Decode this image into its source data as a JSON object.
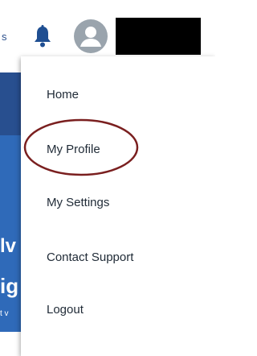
{
  "header": {
    "fragment_text": "s",
    "bell_icon": "bell-icon",
    "avatar_icon": "user-avatar-icon",
    "username_redacted": ""
  },
  "background": {
    "fragments": [
      "lv",
      "ig",
      "t v"
    ]
  },
  "menu": {
    "items": [
      {
        "label": "Home"
      },
      {
        "label": "My Profile"
      },
      {
        "label": "My Settings"
      },
      {
        "label": "Contact Support"
      },
      {
        "label": "Logout"
      }
    ]
  },
  "colors": {
    "bell": "#1f4f92",
    "avatar": "#9aa4ad",
    "highlight_ellipse": "#7a1f1f",
    "background_blue": "#2f6ab9"
  }
}
